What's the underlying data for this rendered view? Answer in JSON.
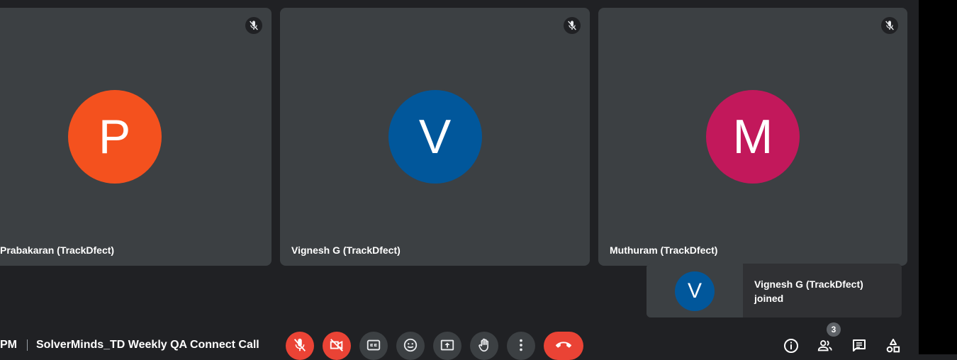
{
  "participants": [
    {
      "initial": "P",
      "name": "Prabakaran (TrackDfect)",
      "color": "#f4511e"
    },
    {
      "initial": "V",
      "name": "Vignesh G (TrackDfect)",
      "color": "#01579b"
    },
    {
      "initial": "M",
      "name": "Muthuram (TrackDfect)",
      "color": "#c2185b"
    }
  ],
  "toast": {
    "initial": "V",
    "line1": "Vignesh G (TrackDfect)",
    "line2": "joined"
  },
  "meeting": {
    "time": "PM",
    "title": "SolverMinds_TD Weekly QA Connect Call"
  },
  "people_count": "3",
  "colors": {
    "danger": "#ea4335",
    "tile": "#3c4043",
    "background": "#202124"
  },
  "icons": {
    "tile_status": "mic-off-icon",
    "controls": [
      "mic-off-icon",
      "camera-off-icon",
      "captions-icon",
      "emoji-icon",
      "present-icon",
      "raise-hand-icon",
      "more-options-icon",
      "hang-up-icon"
    ],
    "side": [
      "info-icon",
      "people-icon",
      "chat-icon",
      "activities-icon"
    ]
  }
}
